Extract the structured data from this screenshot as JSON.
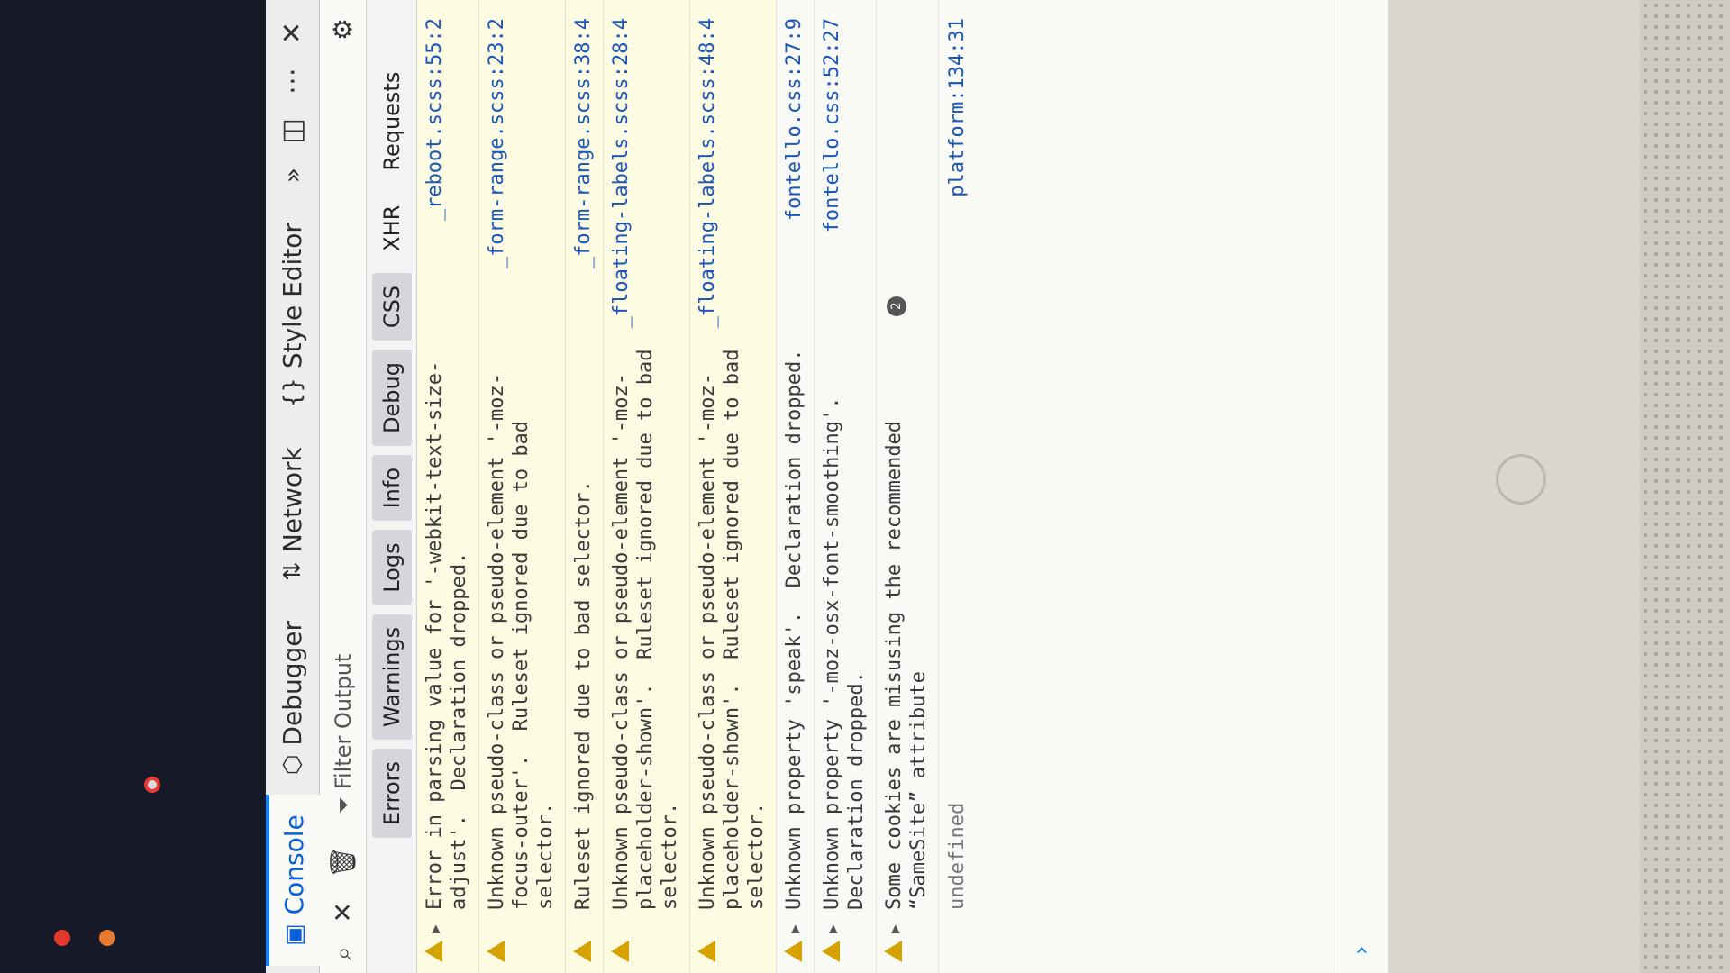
{
  "tabs": {
    "console": "Console",
    "debugger": "Debugger",
    "network": "Network",
    "style_editor": "Style Editor"
  },
  "toolbar": {
    "filter_placeholder": "Filter Output"
  },
  "levels": [
    "Errors",
    "Warnings",
    "Logs",
    "Info",
    "Debug",
    "CSS",
    "XHR",
    "Requests"
  ],
  "messages": [
    {
      "text": "Error in parsing value for '-webkit-text-size-adjust'.  Declaration dropped.",
      "location": "_reboot.scss:55:2",
      "expandable": true
    },
    {
      "text": "Unknown pseudo-class or pseudo-element '-moz-focus-outer'.  Ruleset ignored due to bad selector.",
      "location": "_form-range.scss:23:2",
      "expandable": false
    },
    {
      "text": "Ruleset ignored due to bad selector.",
      "location": "_form-range.scss:38:4",
      "expandable": false
    },
    {
      "text": "Unknown pseudo-class or pseudo-element '-moz-placeholder-shown'.  Ruleset ignored due to bad selector.",
      "location": "_floating-labels.scss:28:4",
      "expandable": false
    },
    {
      "text": "Unknown pseudo-class or pseudo-element '-moz-placeholder-shown'.  Ruleset ignored due to bad selector.",
      "location": "_floating-labels.scss:48:4",
      "expandable": false
    },
    {
      "text": "Unknown property 'speak'.  Declaration dropped.",
      "location": "fontello.css:27:9",
      "expandable": true
    },
    {
      "text": "Unknown property '-moz-osx-font-smoothing'.  Declaration dropped.",
      "location": "fontello.css:52:27",
      "expandable": true
    },
    {
      "text": "Some cookies are misusing the recommended “SameSite” attribute",
      "location": "",
      "badge": "2",
      "expandable": true
    }
  ],
  "result": {
    "text": "undefined",
    "location": "platform:134:31"
  },
  "icons": {
    "console": "console-icon",
    "debugger": "debugger-icon",
    "network": "network-icon",
    "style_editor": "style-editor-icon",
    "more_tabs": "chevron-double-right-icon",
    "dock": "dock-icon",
    "menu": "more-dots-icon",
    "close": "close-icon",
    "trash": "trash-icon",
    "filter": "filter-icon",
    "settings": "gear-icon",
    "warning": "warning-icon"
  },
  "colors": {
    "active_tab": "#0a84ff",
    "warning_row_bg": "#fdfbe2",
    "warning_icon": "#d4a300",
    "link": "#1a57b8"
  }
}
